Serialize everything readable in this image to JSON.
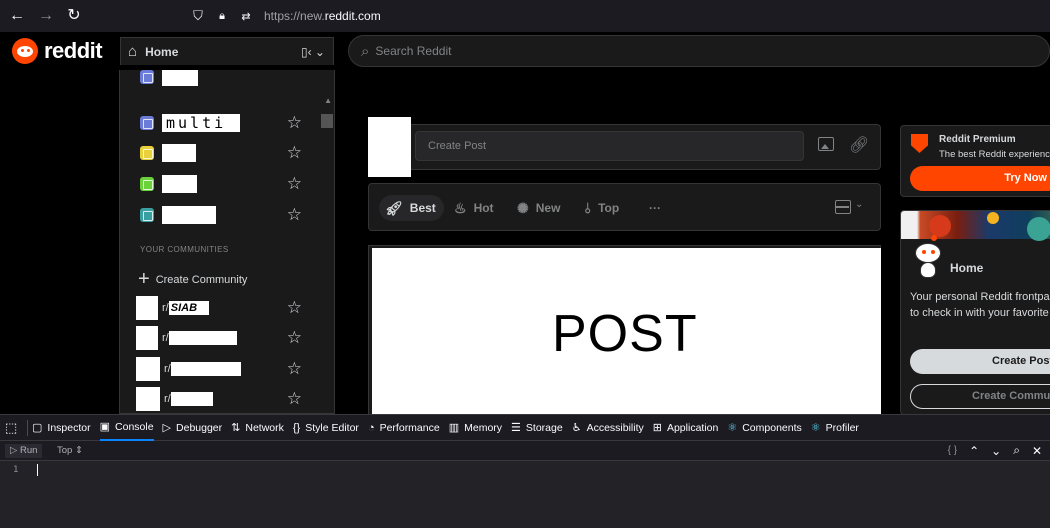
{
  "browser": {
    "url_prefix": "https://new.",
    "url_domain": "reddit.com"
  },
  "header": {
    "logo_text": "reddit",
    "home_label": "Home",
    "search_placeholder": "Search Reddit"
  },
  "dropdown": {
    "multi_label": "multi",
    "section_label": "YOUR COMMUNITIES",
    "create_community": "Create Community",
    "sub_prefix": "r/",
    "first_sub": "SIAB",
    "feed_colors": [
      "#6a7bd8",
      "#6a7bd8",
      "#e9d13b",
      "#6ad33a",
      "#3a9fa3"
    ]
  },
  "create_post": {
    "placeholder": "Create Post"
  },
  "sort": {
    "best": "Best",
    "hot": "Hot",
    "new": "New",
    "top": "Top",
    "more": "···"
  },
  "post": {
    "title": "POST"
  },
  "premium": {
    "title": "Reddit Premium",
    "subtitle": "The best Reddit experience",
    "button": "Try Now"
  },
  "home_card": {
    "title": "Home",
    "desc_line1": "Your personal Reddit frontpage. Come here",
    "desc_line2": "to check in with your favorite communities.",
    "create_post": "Create Post",
    "create_community": "Create Community"
  },
  "devtools": {
    "tabs": [
      "Inspector",
      "Console",
      "Debugger",
      "Network",
      "Style Editor",
      "Performance",
      "Memory",
      "Storage",
      "Accessibility",
      "Application",
      "Components",
      "Profiler"
    ],
    "active_tab": "Console",
    "run": "Run",
    "context": "Top",
    "line_number": "1",
    "braces": "{ }"
  },
  "colors": {
    "accent": "#ff4500",
    "devtools_active": "#0a84ff"
  }
}
